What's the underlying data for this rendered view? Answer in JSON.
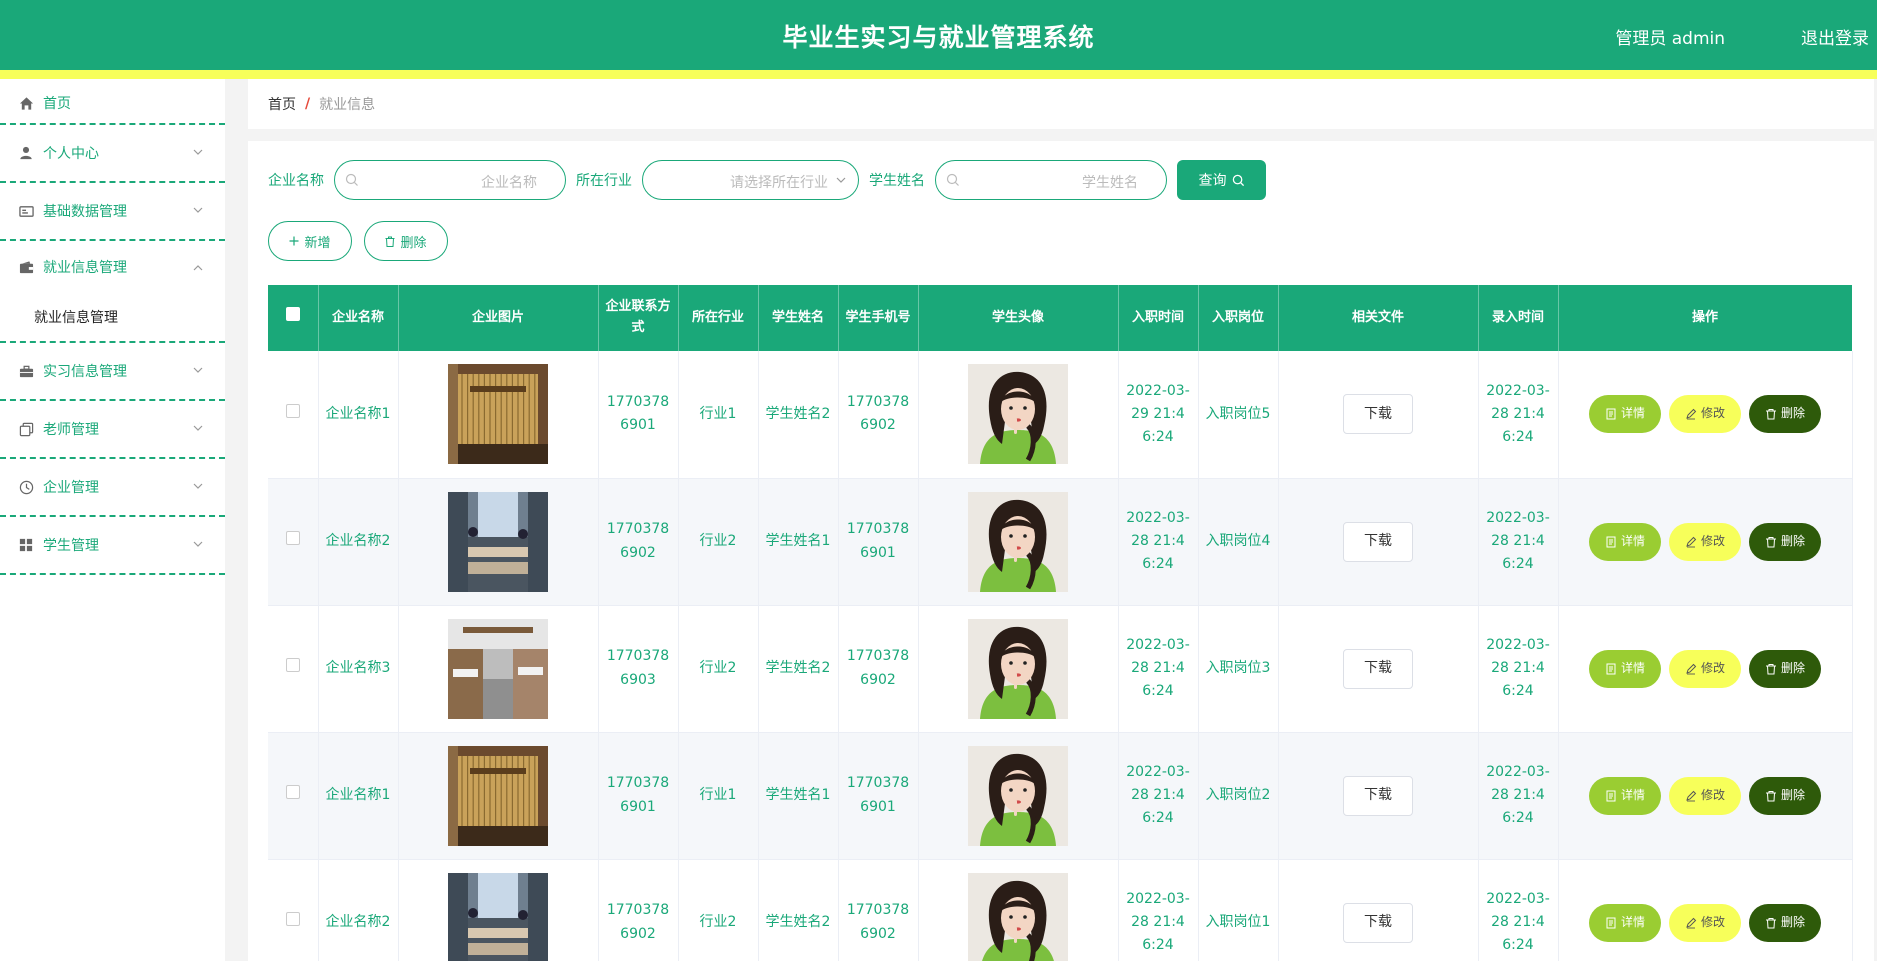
{
  "header": {
    "title": "毕业生实习与就业管理系统",
    "user": "管理员 admin",
    "logout": "退出登录"
  },
  "sidebar": {
    "items": [
      {
        "label": "首页",
        "icon": "home-icon"
      },
      {
        "label": "个人中心",
        "icon": "user-icon"
      },
      {
        "label": "基础数据管理",
        "icon": "id-card-icon"
      },
      {
        "label": "就业信息管理",
        "icon": "wallet-icon",
        "open": true,
        "sub": "就业信息管理"
      },
      {
        "label": "实习信息管理",
        "icon": "briefcase-icon"
      },
      {
        "label": "老师管理",
        "icon": "copy-icon"
      },
      {
        "label": "企业管理",
        "icon": "clock-icon"
      },
      {
        "label": "学生管理",
        "icon": "grid-icon"
      }
    ]
  },
  "breadcrumb": {
    "home": "首页",
    "separator": "/",
    "current": "就业信息"
  },
  "search": {
    "company_label": "企业名称",
    "company_placeholder": "企业名称",
    "industry_label": "所在行业",
    "industry_placeholder": "请选择所在行业",
    "student_label": "学生姓名",
    "student_placeholder": "学生姓名",
    "query_label": "查询"
  },
  "actions": {
    "add": "新增",
    "delete": "删除"
  },
  "table": {
    "headers": [
      "企业名称",
      "企业图片",
      "企业联系方式",
      "所在行业",
      "学生姓名",
      "学生手机号",
      "学生头像",
      "入职时间",
      "入职岗位",
      "相关文件",
      "录入时间",
      "操作"
    ],
    "download_label": "下载",
    "op_detail": "详情",
    "op_edit": "修改",
    "op_delete": "删除",
    "rows": [
      {
        "company": "企业名称1",
        "phone": "17703786901",
        "industry": "行业1",
        "student": "学生姓名2",
        "student_phone": "17703786902",
        "join_time": "2022-03-29 21:46:24",
        "position": "入职岗位5",
        "entry_time": "2022-03-28 21:46:24",
        "img": "a"
      },
      {
        "company": "企业名称2",
        "phone": "17703786902",
        "industry": "行业2",
        "student": "学生姓名1",
        "student_phone": "17703786901",
        "join_time": "2022-03-28 21:46:24",
        "position": "入职岗位4",
        "entry_time": "2022-03-28 21:46:24",
        "img": "b"
      },
      {
        "company": "企业名称3",
        "phone": "17703786903",
        "industry": "行业2",
        "student": "学生姓名2",
        "student_phone": "17703786902",
        "join_time": "2022-03-28 21:46:24",
        "position": "入职岗位3",
        "entry_time": "2022-03-28 21:46:24",
        "img": "c"
      },
      {
        "company": "企业名称1",
        "phone": "17703786901",
        "industry": "行业1",
        "student": "学生姓名1",
        "student_phone": "17703786901",
        "join_time": "2022-03-28 21:46:24",
        "position": "入职岗位2",
        "entry_time": "2022-03-28 21:46:24",
        "img": "a"
      },
      {
        "company": "企业名称2",
        "phone": "17703786902",
        "industry": "行业2",
        "student": "学生姓名2",
        "student_phone": "17703786902",
        "join_time": "2022-03-28 21:46:24",
        "position": "入职岗位1",
        "entry_time": "2022-03-28 21:46:24",
        "img": "b"
      }
    ]
  },
  "colors": {
    "primary": "#1aa879",
    "accent_yellow": "#f7ff5a",
    "detail": "#9acd32",
    "delete": "#2e5a0a"
  }
}
